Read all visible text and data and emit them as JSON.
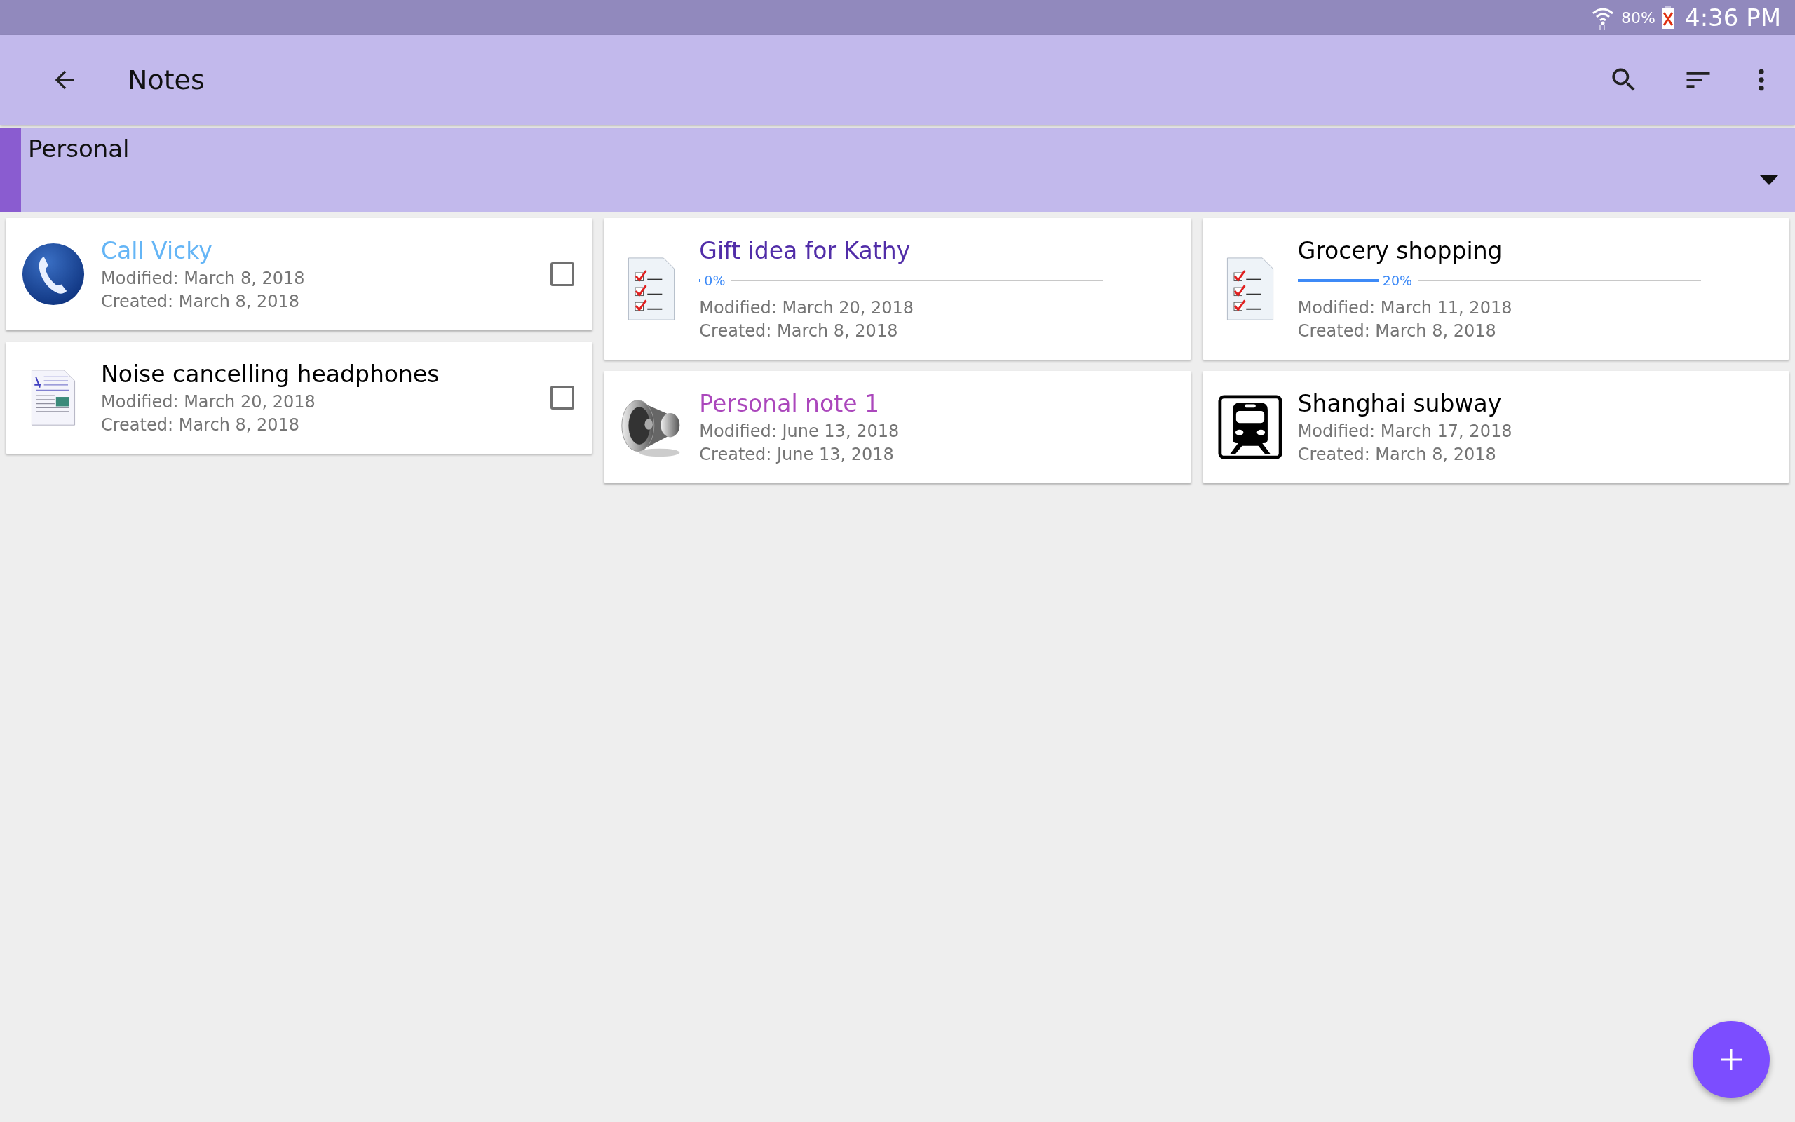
{
  "status_bar": {
    "battery": "80%",
    "time": "4:36 PM"
  },
  "app_bar": {
    "title": "Notes"
  },
  "category": {
    "label": "Personal"
  },
  "columns": [
    {
      "notes": [
        {
          "kind": "phone",
          "title": "Call Vicky",
          "color": "#64b5f6",
          "checked": false,
          "modified": "Modified: March 8, 2018",
          "created": "Created: March 8, 2018"
        },
        {
          "kind": "document",
          "title": "Noise cancelling headphones",
          "color": "#000000",
          "checked": false,
          "modified": "Modified: March 20, 2018",
          "created": "Created: March 8, 2018"
        }
      ]
    },
    {
      "notes": [
        {
          "kind": "checklist",
          "title": "Gift idea for Kathy",
          "color": "#512da8",
          "progress": {
            "level": 0,
            "reading": "0%"
          },
          "modified": "Modified: March 20, 2018",
          "created": "Created: March 8, 2018"
        },
        {
          "kind": "speaker",
          "title": "Personal note 1",
          "color": "#ab47bc",
          "modified": "Modified: June 13, 2018",
          "created": "Created: June 13, 2018"
        }
      ]
    },
    {
      "notes": [
        {
          "kind": "checklist",
          "title": "Grocery shopping",
          "color": "#000000",
          "progress": {
            "level": 0.2,
            "reading": "20%"
          },
          "modified": "Modified: March 11, 2018",
          "created": "Created: March 8, 2018"
        },
        {
          "kind": "train",
          "title": "Shanghai subway",
          "color": "#000000",
          "modified": "Modified: March 17, 2018",
          "created": "Created: March 8, 2018"
        }
      ]
    }
  ]
}
